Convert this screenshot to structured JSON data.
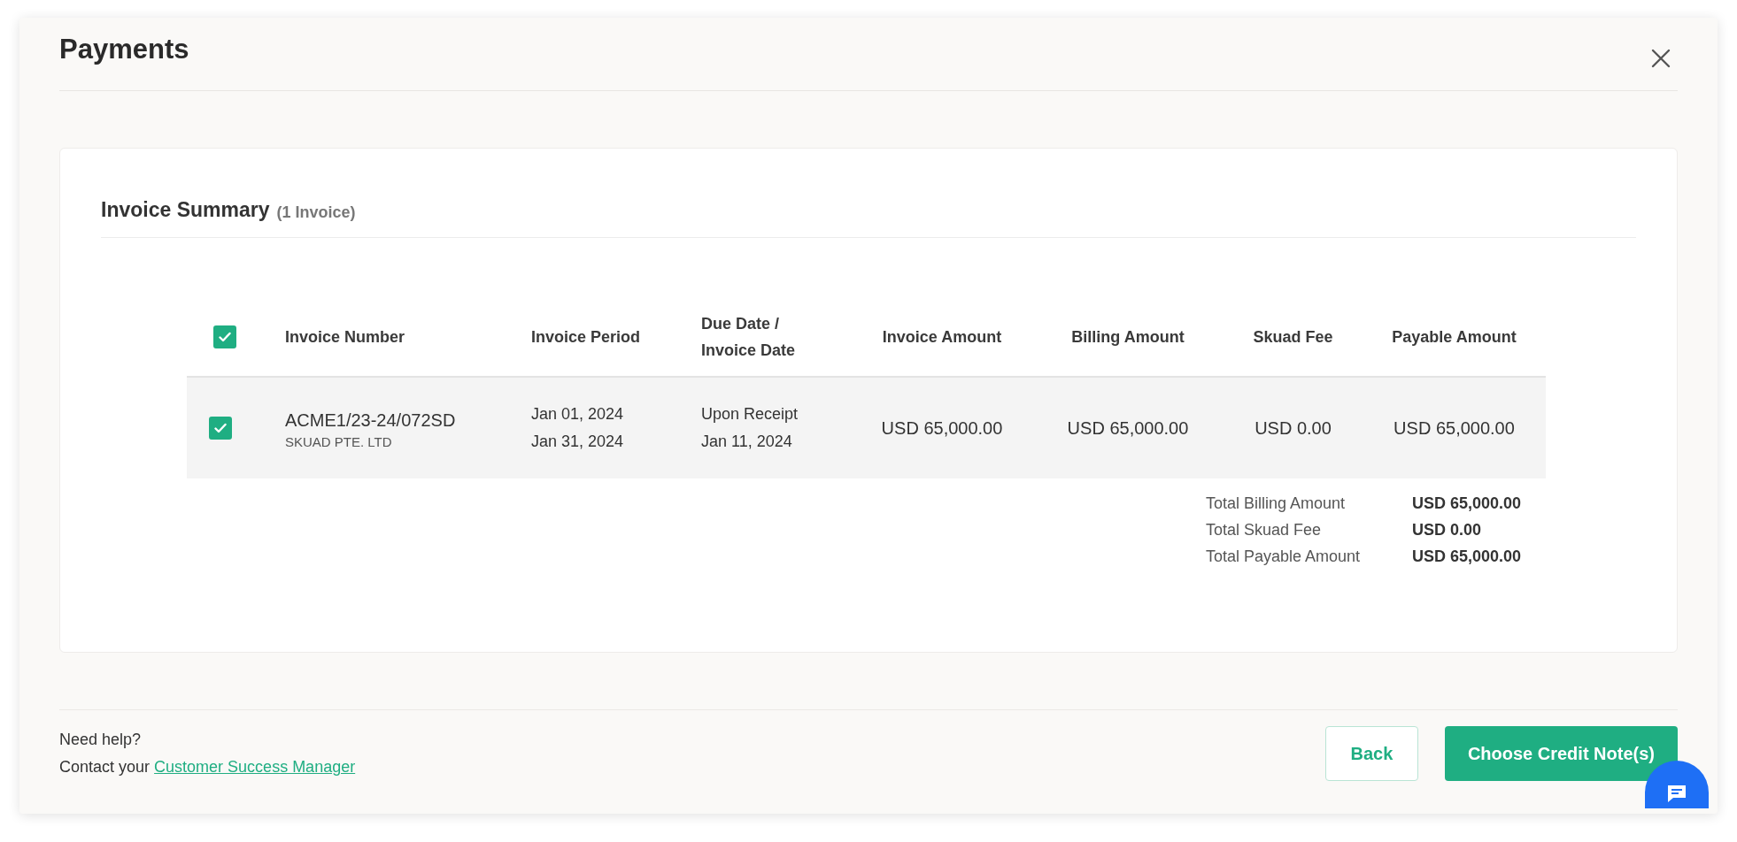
{
  "modal": {
    "title": "Payments"
  },
  "summary": {
    "heading": "Invoice Summary",
    "count": "(1 Invoice)"
  },
  "table": {
    "select_all": {
      "checked": true
    },
    "columns": [
      "Invoice Number",
      "Invoice Period",
      "Due Date / Invoice Date",
      "Invoice Amount",
      "Billing Amount",
      "Skuad Fee",
      "Payable Amount"
    ],
    "rows": [
      {
        "checked": true,
        "invoice_number": "ACME1/23-24/072SD",
        "entity": "SKUAD PTE. LTD",
        "period_start": "Jan 01, 2024",
        "period_end": "Jan 31, 2024",
        "due_date": "Upon Receipt",
        "invoice_date": "Jan 11, 2024",
        "invoice_amount": "USD 65,000.00",
        "billing_amount": "USD 65,000.00",
        "skuad_fee": "USD 0.00",
        "payable_amount": "USD 65,000.00"
      }
    ]
  },
  "totals": [
    {
      "label": "Total Billing Amount",
      "value": "USD 65,000.00"
    },
    {
      "label": "Total Skuad Fee",
      "value": "USD 0.00"
    },
    {
      "label": "Total Payable Amount",
      "value": "USD 65,000.00"
    }
  ],
  "footer": {
    "help": "Need help?",
    "contact_prefix": "Contact your",
    "contact_link": "Customer Success Manager"
  },
  "buttons": [
    {
      "label": "Back",
      "kind": "secondary"
    },
    {
      "label": "Choose Credit Note(s)",
      "kind": "primary"
    }
  ]
}
